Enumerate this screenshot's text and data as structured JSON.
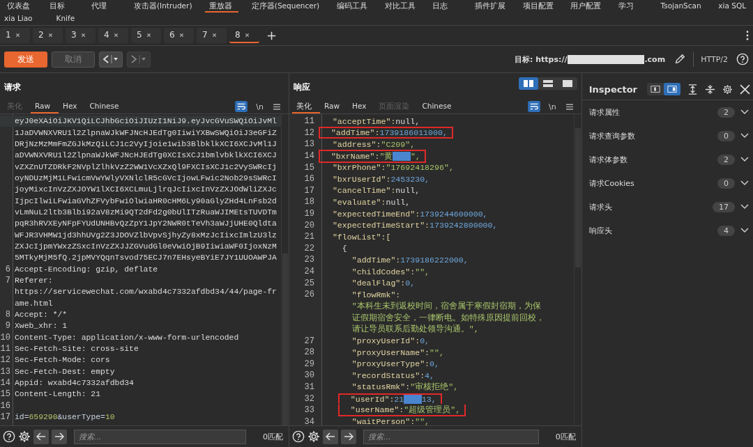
{
  "tool_tab_rows": [
    {
      "items": [
        {
          "label": "仪表盘",
          "selected": false
        },
        {
          "label": "目标",
          "selected": false
        },
        {
          "label": "代理",
          "selected": false
        },
        {
          "label": "攻击器(Intruder)",
          "selected": false
        },
        {
          "label": "重放器",
          "selected": true
        },
        {
          "label": "定序器(Sequencer)",
          "selected": false
        },
        {
          "label": "编码工具",
          "selected": false
        },
        {
          "label": "对比工具",
          "selected": false
        },
        {
          "label": "日志",
          "selected": false
        },
        {
          "label": "插件扩展",
          "selected": false
        },
        {
          "label": "项目配置",
          "selected": false
        },
        {
          "label": "用户配置",
          "selected": false
        },
        {
          "label": "学习",
          "selected": false
        },
        {
          "label": "TsojanScan",
          "selected": false
        },
        {
          "label": "xia SQL",
          "selected": false
        }
      ]
    },
    {
      "items": [
        {
          "label": "xia Liao",
          "selected": false
        },
        {
          "label": "Knife",
          "selected": false
        }
      ]
    }
  ],
  "repeater_tabs": [
    {
      "label": "1",
      "selected": false
    },
    {
      "label": "2",
      "selected": false
    },
    {
      "label": "3",
      "selected": false
    },
    {
      "label": "4",
      "selected": false
    },
    {
      "label": "5",
      "selected": false
    },
    {
      "label": "6",
      "selected": false
    },
    {
      "label": "7",
      "selected": false
    },
    {
      "label": "8",
      "selected": true
    }
  ],
  "add_tab": "+",
  "toolbar": {
    "send": "发送",
    "cancel": {
      "label": "取消",
      "disabled": true
    },
    "back_disabled": false,
    "forward_disabled": true,
    "target_prefix": "目标: https://",
    "target_suffix": ".com",
    "protocol": "HTTP/2"
  },
  "request": {
    "title": "请求",
    "tabs": [
      {
        "label": "美化",
        "selected": false,
        "disabled": true
      },
      {
        "label": "Raw",
        "selected": true,
        "disabled": false
      },
      {
        "label": "Hex",
        "selected": false,
        "disabled": false
      },
      {
        "label": "Chinese",
        "selected": false,
        "disabled": false
      }
    ],
    "newline_toggle": "\\n",
    "lines": [
      {
        "current": true,
        "tokens": [
          {
            "text": "eyJ0eXAiOiJKV1QiLCJhbGciOiJIUzI1NiJ9.eyJvcGVuSWQiOiJvMl",
            "kind": "plain"
          }
        ]
      },
      {
        "tokens": [
          {
            "text": "1JaDVWNXVRU1l2ZlpnaWJkWFJNcHJEdTg0IiwiYXBwSWQiOiJ3eGFiZ",
            "kind": "plain"
          }
        ]
      },
      {
        "tokens": [
          {
            "text": "DRjNzMzMmFmZGJkMzQiLCJ1c2VyIjoie1wib3BlbklkXCI6XCJvMl1J",
            "kind": "plain"
          }
        ]
      },
      {
        "tokens": [
          {
            "text": "aDVWNXVRU1l2ZlpnaWJkWFJNcHJEdTg0XCIsXCJ1bmlvbklkXCI6XCJ",
            "kind": "plain"
          }
        ]
      },
      {
        "tokens": [
          {
            "text": "vZXZnUTZDRkF2NVplZlhkVzZ2WW1VcXZxQl9FXCIsXCJ1c2VySWRcIj",
            "kind": "plain"
          }
        ]
      },
      {
        "tokens": [
          {
            "text": "oyNDUzMjM1LFwicmVwYWlyVXNlclR5cGVcIjowLFwic2Nob29sSWRcI",
            "kind": "plain"
          }
        ]
      },
      {
        "tokens": [
          {
            "text": "joyMixcInVzZXJOYW1lXCI6XCLmuLjlrqJcIixcInVzZXJOdWliZXJc",
            "kind": "plain"
          }
        ]
      },
      {
        "tokens": [
          {
            "text": "IjpcIlwiLFwiaGVhZFVybFwiOlwiaHR0cHM6Ly90aGlyZHd4LnFsb2d",
            "kind": "plain"
          }
        ]
      },
      {
        "tokens": [
          {
            "text": "vLmNuL2ltb3Blbi92aV8zMi9QT2dFd2g0bUlITzRuaWJIMEtsTUVDTm",
            "kind": "plain"
          }
        ]
      },
      {
        "tokens": [
          {
            "text": "pqR3hRVXEyNFpFYUdUNHBvQzZpY1JpY2NWR0tTeVh3aWJjUHE0Qldta",
            "kind": "plain"
          }
        ]
      },
      {
        "tokens": [
          {
            "text": "WFJR3VHMW1jd3hhUVg2Z3JDOVZlbVpvSjhyZy8xMzJcIixcImlzU3lz",
            "kind": "plain"
          }
        ]
      },
      {
        "tokens": [
          {
            "text": "ZXJcIjpmYWxzZSxcInVzZXJJZGVudGl0eVwiOjB9IiwiaWF0IjoxNzM",
            "kind": "plain"
          }
        ]
      },
      {
        "tokens": [
          {
            "text": "5MTkyMjM5fQ.2jpMVYQqnTsvod75ECJ7n7EHsyeBYiE7JY1UUOAWPJA",
            "kind": "plain"
          }
        ]
      },
      {
        "num": "6",
        "tokens": [
          {
            "text": "Accept-Encoding: gzip, deflate",
            "kind": "plain"
          }
        ]
      },
      {
        "num": "7",
        "tokens": [
          {
            "text": "Referer:",
            "kind": "plain"
          }
        ]
      },
      {
        "tokens": [
          {
            "text": "https://servicewechat.com/wxabd4c7332afdbd34/44/page-fr",
            "kind": "plain"
          }
        ]
      },
      {
        "tokens": [
          {
            "text": "ame.html",
            "kind": "plain"
          }
        ]
      },
      {
        "num": "8",
        "tokens": [
          {
            "text": "Accept: */*",
            "kind": "plain"
          }
        ]
      },
      {
        "num": "9",
        "tokens": [
          {
            "text": "Xweb_xhr: 1",
            "kind": "plain"
          }
        ]
      },
      {
        "num": "10",
        "tokens": [
          {
            "text": "Content-Type: application/x-www-form-urlencoded",
            "kind": "plain"
          }
        ]
      },
      {
        "num": "11",
        "tokens": [
          {
            "text": "Sec-Fetch-Site: cross-site",
            "kind": "plain"
          }
        ]
      },
      {
        "num": "12",
        "tokens": [
          {
            "text": "Sec-Fetch-Mode: cors",
            "kind": "plain"
          }
        ]
      },
      {
        "num": "13",
        "tokens": [
          {
            "text": "Sec-Fetch-Dest: empty",
            "kind": "plain"
          }
        ]
      },
      {
        "num": "14",
        "tokens": [
          {
            "text": "Appid: wxabd4c7332afdbd34",
            "kind": "plain"
          }
        ]
      },
      {
        "num": "15",
        "tokens": [
          {
            "text": "Content-Length: 21",
            "kind": "plain"
          }
        ]
      },
      {
        "num": "16"
      },
      {
        "num": "17",
        "tokens": [
          {
            "text": "id=",
            "kind": "param"
          },
          {
            "text": "659290",
            "kind": "value"
          },
          {
            "text": "&userType=",
            "kind": "param"
          },
          {
            "text": "10",
            "kind": "value"
          }
        ]
      }
    ],
    "search_placeholder": "搜索...",
    "matches": "0匹配"
  },
  "response": {
    "title": "响应",
    "layouts": [
      {
        "kind": "columns",
        "selected": true
      },
      {
        "kind": "rows",
        "selected": false
      },
      {
        "kind": "single",
        "selected": false
      }
    ],
    "tabs": [
      {
        "label": "美化",
        "selected": true,
        "disabled": false
      },
      {
        "label": "Raw",
        "selected": false,
        "disabled": false
      },
      {
        "label": "Hex",
        "selected": false,
        "disabled": false
      },
      {
        "label": "页面渲染",
        "selected": false,
        "disabled": true
      },
      {
        "label": "Chinese",
        "selected": false,
        "disabled": false
      }
    ],
    "newline_toggle": "\\n",
    "lines": [
      {
        "num": "11",
        "tokens": [
          {
            "text": "\"acceptTime\":",
            "kind": "key"
          },
          {
            "text": "null,",
            "kind": "plain"
          }
        ]
      },
      {
        "num": "12",
        "boxed": true,
        "tokens": [
          {
            "text": "\"addTime\":",
            "kind": "key"
          },
          {
            "text": "1739186011000,",
            "kind": "number"
          }
        ]
      },
      {
        "num": "13",
        "tokens": [
          {
            "text": "\"address\":",
            "kind": "key"
          },
          {
            "text": "\"C209\",",
            "kind": "string"
          }
        ]
      },
      {
        "num": "14",
        "boxed": true,
        "tokens": [
          {
            "text": "\"bxrName\":",
            "kind": "key"
          },
          {
            "text": "\"黄",
            "kind": "string"
          },
          {
            "kind": "redacted"
          },
          {
            "text": "\",",
            "kind": "string"
          }
        ]
      },
      {
        "num": "15",
        "tokens": [
          {
            "text": "\"bxrPhone\":",
            "kind": "key"
          },
          {
            "text": "\"17692418296\",",
            "kind": "string"
          }
        ]
      },
      {
        "num": "16",
        "tokens": [
          {
            "text": "\"bxrUserId\":",
            "kind": "key"
          },
          {
            "text": "2453230,",
            "kind": "number"
          }
        ]
      },
      {
        "num": "17",
        "tokens": [
          {
            "text": "\"cancelTime\":",
            "kind": "key"
          },
          {
            "text": "null,",
            "kind": "plain"
          }
        ]
      },
      {
        "num": "18",
        "tokens": [
          {
            "text": "\"evaluate\":",
            "kind": "key"
          },
          {
            "text": "null,",
            "kind": "plain"
          }
        ]
      },
      {
        "num": "19",
        "tokens": [
          {
            "text": "\"expectedTimeEnd\":",
            "kind": "key"
          },
          {
            "text": "1739244600000,",
            "kind": "number"
          }
        ]
      },
      {
        "num": "20",
        "tokens": [
          {
            "text": "\"expectedTimeStart\":",
            "kind": "key"
          },
          {
            "text": "1739242800000,",
            "kind": "number"
          }
        ]
      },
      {
        "num": "21",
        "tokens": [
          {
            "text": "\"flowList\":[",
            "kind": "key"
          }
        ],
        "children": [
          {
            "num": "22",
            "tokens": [
              {
                "text": "{",
                "kind": "plain"
              }
            ],
            "children": [
              {
                "num": "23",
                "tokens": [
                  {
                    "text": "\"addTime\":",
                    "kind": "key"
                  },
                  {
                    "text": "1739186222000,",
                    "kind": "number"
                  }
                ]
              },
              {
                "num": "24",
                "tokens": [
                  {
                    "text": "\"childCodes\":",
                    "kind": "key"
                  },
                  {
                    "text": "\"\",",
                    "kind": "string"
                  }
                ]
              },
              {
                "num": "25",
                "tokens": [
                  {
                    "text": "\"dealFlag\":",
                    "kind": "key"
                  },
                  {
                    "text": "0,",
                    "kind": "number"
                  }
                ]
              },
              {
                "num": "26",
                "tokens": [
                  {
                    "text": "\"flowRmk\":",
                    "kind": "key"
                  }
                ]
              },
              {
                "tokens": [
                  {
                    "text": "\"本科生未到返校时间，宿舍属于寒假封宿期，为保",
                    "kind": "string"
                  }
                ]
              },
              {
                "tokens": [
                  {
                    "text": "证假期宿舍安全，一律断电。如特殊原因提前回校，",
                    "kind": "string"
                  }
                ]
              },
              {
                "tokens": [
                  {
                    "text": "请让导员联系后勤处领导沟通。\",",
                    "kind": "string"
                  }
                ]
              },
              {
                "num": "27",
                "tokens": [
                  {
                    "text": "\"proxyUserId\":",
                    "kind": "key"
                  },
                  {
                    "text": "0,",
                    "kind": "number"
                  }
                ]
              },
              {
                "num": "28",
                "tokens": [
                  {
                    "text": "\"proxyUserName\":",
                    "kind": "key"
                  },
                  {
                    "text": "\"\",",
                    "kind": "string"
                  }
                ]
              },
              {
                "num": "29",
                "tokens": [
                  {
                    "text": "\"proxyUserType\":",
                    "kind": "key"
                  },
                  {
                    "text": "0,",
                    "kind": "number"
                  }
                ]
              },
              {
                "num": "30",
                "tokens": [
                  {
                    "text": "\"recordStatus\":",
                    "kind": "key"
                  },
                  {
                    "text": "4,",
                    "kind": "number"
                  }
                ]
              },
              {
                "num": "31",
                "tokens": [
                  {
                    "text": "\"statusRmk\":",
                    "kind": "key"
                  },
                  {
                    "text": "\"审核拒绝\",",
                    "kind": "string"
                  }
                ]
              },
              {
                "num": "32",
                "boxed": true,
                "tokens": [
                  {
                    "text": "\"userId\":",
                    "kind": "key"
                  },
                  {
                    "text": "21",
                    "kind": "number"
                  },
                  {
                    "kind": "redacted"
                  },
                  {
                    "text": "13,",
                    "kind": "number"
                  }
                ]
              },
              {
                "num": "33",
                "boxed": true,
                "tokens": [
                  {
                    "text": "\"userName\":",
                    "kind": "key"
                  },
                  {
                    "text": "\"超级管理员\",",
                    "kind": "string"
                  }
                ]
              },
              {
                "num": "34",
                "tokens": [
                  {
                    "text": "\"waitPerson\":",
                    "kind": "key"
                  },
                  {
                    "text": "\"\",",
                    "kind": "string"
                  }
                ]
              }
            ]
          }
        ]
      }
    ],
    "search_placeholder": "搜索...",
    "matches": "0匹配"
  },
  "inspector": {
    "title": "Inspector",
    "docked_right": true,
    "sections": [
      {
        "label": "请求属性",
        "count": "2"
      },
      {
        "label": "请求查询参数",
        "count": "0"
      },
      {
        "label": "请求体参数",
        "count": "2"
      },
      {
        "label": "请求Cookies",
        "count": "0"
      },
      {
        "label": "请求头",
        "count": "17"
      },
      {
        "label": "响应头",
        "count": "4"
      }
    ]
  }
}
